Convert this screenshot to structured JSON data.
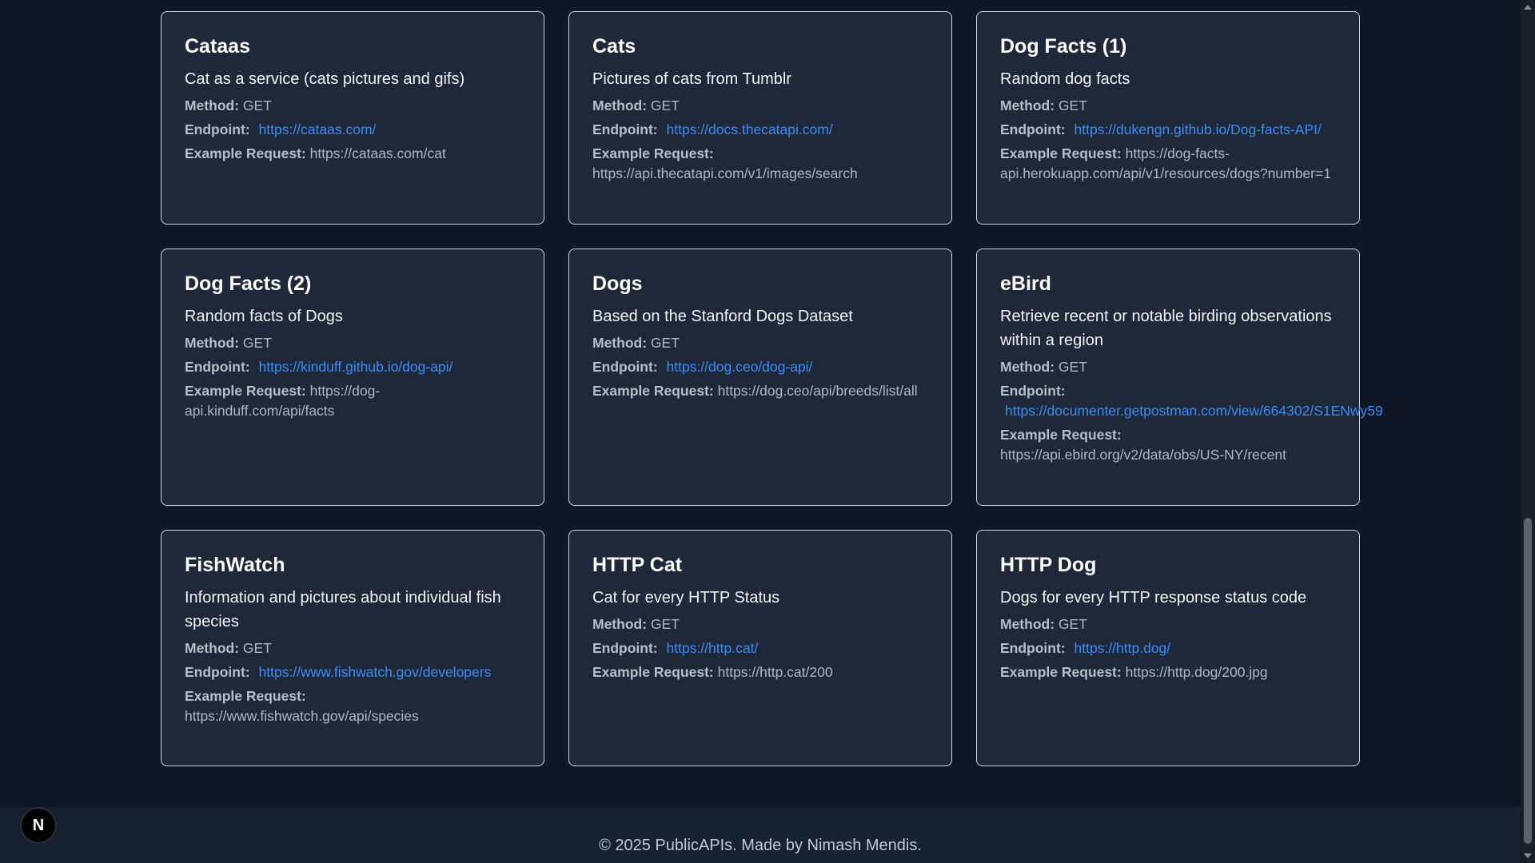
{
  "cards": [
    {
      "title": "Cataas",
      "description": "Cat as a service (cats pictures and gifs)",
      "method_label": "Method:",
      "method": "GET",
      "endpoint_label": "Endpoint:",
      "endpoint": "https://cataas.com/",
      "example_label": "Example Request:",
      "example": "https://cataas.com/cat"
    },
    {
      "title": "Cats",
      "description": "Pictures of cats from Tumblr",
      "method_label": "Method:",
      "method": "GET",
      "endpoint_label": "Endpoint:",
      "endpoint": "https://docs.thecatapi.com/",
      "example_label": "Example Request:",
      "example": "https://api.thecatapi.com/v1/images/search"
    },
    {
      "title": "Dog Facts (1)",
      "description": "Random dog facts",
      "method_label": "Method:",
      "method": "GET",
      "endpoint_label": "Endpoint:",
      "endpoint": "https://dukengn.github.io/Dog-facts-API/",
      "example_label": "Example Request:",
      "example": "https://dog-facts-api.herokuapp.com/api/v1/resources/dogs?number=1"
    },
    {
      "title": "Dog Facts (2)",
      "description": "Random facts of Dogs",
      "method_label": "Method:",
      "method": "GET",
      "endpoint_label": "Endpoint:",
      "endpoint": "https://kinduff.github.io/dog-api/",
      "example_label": "Example Request:",
      "example": "https://dog-api.kinduff.com/api/facts"
    },
    {
      "title": "Dogs",
      "description": "Based on the Stanford Dogs Dataset",
      "method_label": "Method:",
      "method": "GET",
      "endpoint_label": "Endpoint:",
      "endpoint": "https://dog.ceo/dog-api/",
      "example_label": "Example Request:",
      "example": "https://dog.ceo/api/breeds/list/all"
    },
    {
      "title": "eBird",
      "description": "Retrieve recent or notable birding observations within a region",
      "method_label": "Method:",
      "method": "GET",
      "endpoint_label": "Endpoint:",
      "endpoint": "https://documenter.getpostman.com/view/664302/S1ENwy59",
      "example_label": "Example Request:",
      "example": "https://api.ebird.org/v2/data/obs/US-NY/recent"
    },
    {
      "title": "FishWatch",
      "description": "Information and pictures about individual fish species",
      "method_label": "Method:",
      "method": "GET",
      "endpoint_label": "Endpoint:",
      "endpoint": "https://www.fishwatch.gov/developers",
      "example_label": "Example Request:",
      "example": "https://www.fishwatch.gov/api/species"
    },
    {
      "title": "HTTP Cat",
      "description": "Cat for every HTTP Status",
      "method_label": "Method:",
      "method": "GET",
      "endpoint_label": "Endpoint:",
      "endpoint": "https://http.cat/",
      "example_label": "Example Request:",
      "example": "https://http.cat/200"
    },
    {
      "title": "HTTP Dog",
      "description": "Dogs for every HTTP response status code",
      "method_label": "Method:",
      "method": "GET",
      "endpoint_label": "Endpoint:",
      "endpoint": "https://http.dog/",
      "example_label": "Example Request:",
      "example": "https://http.dog/200.jpg"
    }
  ],
  "footer": {
    "text": "© 2025 PublicAPIs. Made by Nimash Mendis."
  },
  "badge": {
    "letter": "N"
  },
  "colors": {
    "background": "#0f1726",
    "card": "#1e2838",
    "link": "#3b8df5",
    "footer": "#162131"
  }
}
